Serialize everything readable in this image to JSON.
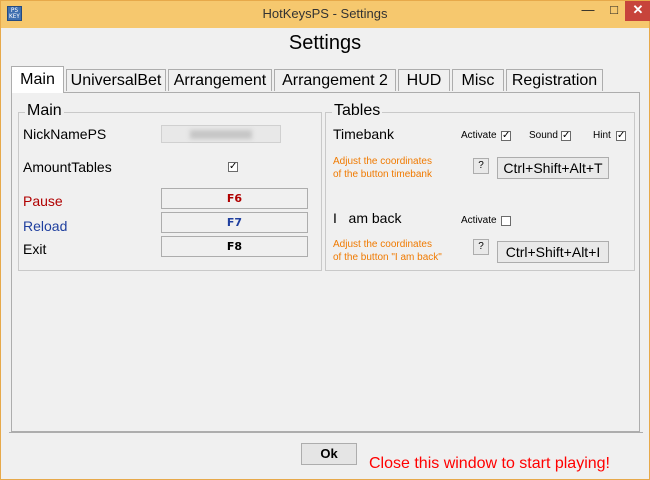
{
  "window": {
    "title": "HotKeysPS - Settings",
    "app_icon_text": "PS\nKEY",
    "controls": {
      "minimize": "—",
      "maximize": "□",
      "close": "✕"
    }
  },
  "page": {
    "heading": "Settings"
  },
  "tabs": [
    {
      "label": "Main"
    },
    {
      "label": "UniversalBet"
    },
    {
      "label": "Arrangement"
    },
    {
      "label": "Arrangement 2"
    },
    {
      "label": "HUD"
    },
    {
      "label": "Misc"
    },
    {
      "label": "Registration"
    }
  ],
  "main": {
    "title": "Main",
    "nickname_label": "NickNamePS",
    "amount_tables_label": "AmountTables",
    "amount_tables_checked": true,
    "pause_label": "Pause",
    "pause_key": "F6",
    "reload_label": "Reload",
    "reload_key": "F7",
    "exit_label": "Exit",
    "exit_key": "F8"
  },
  "tables": {
    "title": "Tables",
    "timebank_label": "Timebank",
    "activate_label": "Activate",
    "activate_checked": true,
    "sound_label": "Sound",
    "sound_checked": true,
    "hint_label": "Hint",
    "hint_checked": true,
    "adjust_text": "Adjust the coordinates\nof the button timebank",
    "help_label": "?",
    "timebank_hotkey": "Ctrl+Shift+Alt+T",
    "iamback_label": "I   am back",
    "iamback_activate_label": "Activate",
    "iamback_activate_checked": false,
    "adjust_iamback_text": "Adjust the coordinates\nof the button \"I am back\"",
    "help2_label": "?",
    "iamback_hotkey": "Ctrl+Shift+Alt+I"
  },
  "footer": {
    "ok_label": "Ok",
    "message": "Close this window to start playing!"
  },
  "colors": {
    "pause": "#b00000",
    "reload": "#1f3f9f",
    "orange": "#f07a00",
    "footer": "#ff0000"
  }
}
